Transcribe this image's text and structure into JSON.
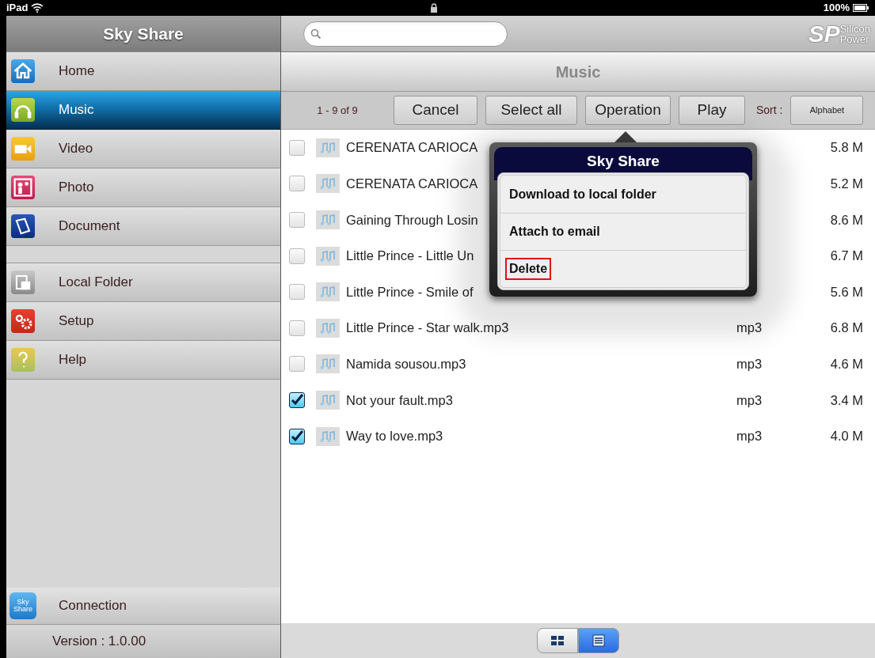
{
  "status_bar": {
    "device": "iPad",
    "battery": "100%"
  },
  "sidebar": {
    "title": "Sky Share",
    "items": [
      {
        "label": "Home",
        "selected": false
      },
      {
        "label": "Music",
        "selected": true
      },
      {
        "label": "Video",
        "selected": false
      },
      {
        "label": "Photo",
        "selected": false
      },
      {
        "label": "Document",
        "selected": false
      }
    ],
    "lower_items": [
      {
        "label": "Local Folder",
        "selected": false
      },
      {
        "label": "Setup",
        "selected": false
      },
      {
        "label": "Help",
        "selected": false
      }
    ],
    "connection": {
      "label": "Connection",
      "icon_text": "Sky Share"
    },
    "version": "Version : 1.0.00"
  },
  "header": {
    "logo_mark": "SP",
    "logo_text": [
      "Silicon",
      "Power"
    ],
    "title": "Music"
  },
  "toolbar": {
    "count": "1 - 9 of 9",
    "buttons": [
      "Cancel",
      "Select all",
      "Operation",
      "Play"
    ],
    "sort_label": "Sort :",
    "sort_value": "Alphabet"
  },
  "files": [
    {
      "name": "CERENATA CARIOCA",
      "size": "5.8 M",
      "checked": false
    },
    {
      "name": "CERENATA CARIOCA",
      "size": "5.2 M",
      "checked": false
    },
    {
      "name": "Gaining Through Losin",
      "size": "8.6 M",
      "checked": false
    },
    {
      "name": "Little Prince - Little Un",
      "size": "6.7 M",
      "checked": false
    },
    {
      "name": "Little Prince - Smile of",
      "size": "5.6 M",
      "checked": false
    },
    {
      "name": "Little Prince - Star walk.mp3",
      "type": "mp3",
      "size": "6.8 M",
      "checked": false
    },
    {
      "name": "Namida sousou.mp3",
      "type": "mp3",
      "size": "4.6 M",
      "checked": false
    },
    {
      "name": "Not your fault.mp3",
      "type": "mp3",
      "size": "3.4 M",
      "checked": true
    },
    {
      "name": "Way to love.mp3",
      "type": "mp3",
      "size": "4.0 M",
      "checked": true
    }
  ],
  "popup": {
    "title": "Sky Share",
    "options": [
      {
        "label": "Download to local folder",
        "highlighted": false
      },
      {
        "label": "Attach to email",
        "highlighted": false
      },
      {
        "label": "Delete",
        "highlighted": true
      }
    ]
  },
  "view_toggle": [
    {
      "selected": false
    },
    {
      "selected": true
    }
  ]
}
